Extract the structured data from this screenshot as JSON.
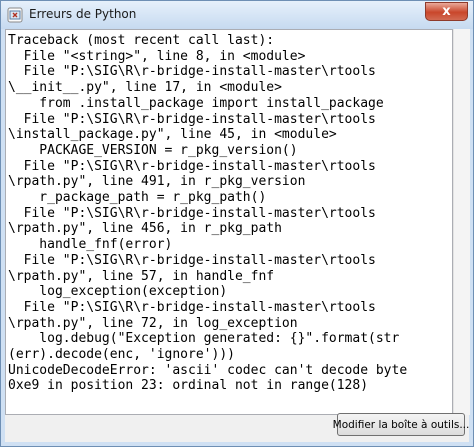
{
  "window": {
    "title": "Erreurs de Python",
    "close_glyph": "x",
    "icon": "python-app-icon"
  },
  "traceback": {
    "lines": [
      "Traceback (most recent call last):",
      "  File \"<string>\", line 8, in <module>",
      "  File \"P:\\SIG\\R\\r-bridge-install-master\\rtools",
      "\\__init__.py\", line 17, in <module>",
      "    from .install_package import install_package",
      "  File \"P:\\SIG\\R\\r-bridge-install-master\\rtools",
      "\\install_package.py\", line 45, in <module>",
      "    PACKAGE_VERSION = r_pkg_version()",
      "  File \"P:\\SIG\\R\\r-bridge-install-master\\rtools",
      "\\rpath.py\", line 491, in r_pkg_version",
      "    r_package_path = r_pkg_path()",
      "  File \"P:\\SIG\\R\\r-bridge-install-master\\rtools",
      "\\rpath.py\", line 456, in r_pkg_path",
      "    handle_fnf(error)",
      "  File \"P:\\SIG\\R\\r-bridge-install-master\\rtools",
      "\\rpath.py\", line 57, in handle_fnf",
      "    log_exception(exception)",
      "  File \"P:\\SIG\\R\\r-bridge-install-master\\rtools",
      "\\rpath.py\", line 72, in log_exception",
      "    log.debug(\"Exception generated: {}\".format(str",
      "(err).decode(enc, 'ignore')))",
      "UnicodeDecodeError: 'ascii' codec can't decode byte",
      "0xe9 in position 23: ordinal not in range(128)"
    ]
  },
  "buttons": {
    "edit_toolbox": "Modifier la boîte à outils..."
  }
}
